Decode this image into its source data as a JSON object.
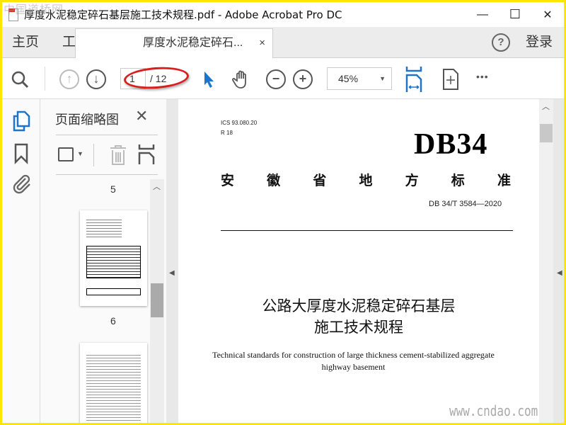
{
  "window": {
    "title": "厚度水泥稳定碎石基层施工技术规程.pdf - Adobe Acrobat Pro DC",
    "minimize": "—",
    "maximize": "☐",
    "close": "✕"
  },
  "tabs": {
    "home": "主页",
    "tools": "工具",
    "document_tab": "厚度水泥稳定碎石...",
    "document_tab_close": "×",
    "help": "?",
    "signin": "登录"
  },
  "toolbar": {
    "current_page": "1",
    "total_pages": "/ 12",
    "zoom": "45%",
    "more": "•••",
    "accent": "#1f73c8"
  },
  "thumbnail_pane": {
    "title": "页面缩略图",
    "close": "✕",
    "pages": [
      {
        "label": "5"
      },
      {
        "label": "6"
      }
    ]
  },
  "document": {
    "ics": "ICS 93.080.20",
    "r": "R 18",
    "code_big": "DB34",
    "issuer": [
      "安",
      "徽",
      "省",
      "地",
      "方",
      "标",
      "准"
    ],
    "standard_no": "DB 34/T 3584—2020",
    "title_line1": "公路大厚度水泥稳定碎石基层",
    "title_line2": "施工技术规程",
    "english_line1": "Technical standards for construction of large thickness cement-stabilized aggregate",
    "english_line2": "highway basement"
  },
  "watermarks": {
    "top_left": "中国道桥网",
    "bottom_right": "www.cndao.com"
  },
  "annotation_color": "#d81e1e"
}
